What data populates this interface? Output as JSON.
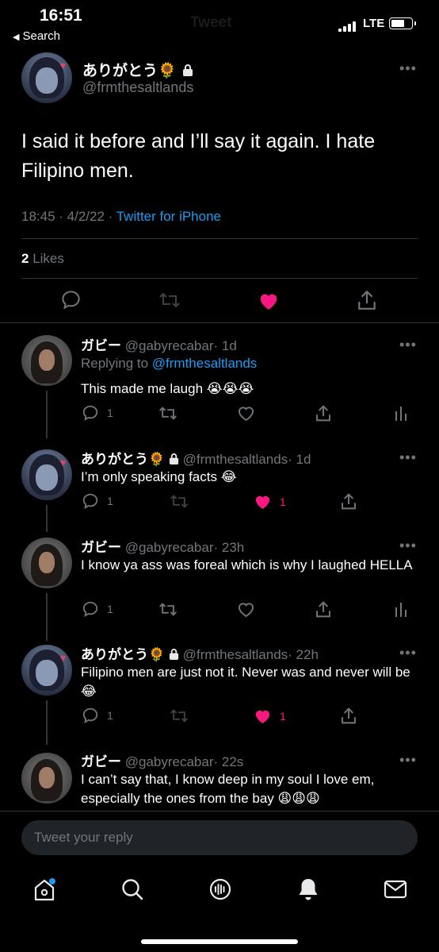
{
  "status_bar": {
    "time": "16:51",
    "back_label": "Search",
    "carrier_title": "Tweet",
    "network": "LTE"
  },
  "main_tweet": {
    "display_name": "ありがとう🌻",
    "handle": "@frmthesaltlands",
    "text": "I said it before and I’ll say it again. I hate Filipino men.",
    "timestamp": "18:45 · 4/2/22 · ",
    "source": "Twitter for iPhone",
    "likes_count": "2",
    "likes_label": " Likes"
  },
  "replies": [
    {
      "display_name": "ガビー",
      "handle": "@gabyrecabar",
      "time": "· 1d",
      "replying_to_label": "Replying to ",
      "replying_to_handle": "@frmthesaltlands",
      "text": "This made me laugh 😭😭😭",
      "reply_count": "1",
      "like_count": ""
    },
    {
      "display_name": "ありがとう🌻",
      "handle": "@frmthesaltlands",
      "time": "· 1d",
      "text": "I’m only speaking facts 😂",
      "reply_count": "1",
      "like_count": "1"
    },
    {
      "display_name": "ガビー",
      "handle": "@gabyrecabar",
      "time": "· 23h",
      "text": "I know ya ass was foreal which is why I laughed HELLA",
      "reply_count": "1",
      "like_count": ""
    },
    {
      "display_name": "ありがとう🌻",
      "handle": "@frmthesaltlands",
      "time": "· 22h",
      "text": "Filipino men are just not it. Never was and never will be 😂",
      "reply_count": "1",
      "like_count": "1"
    },
    {
      "display_name": "ガビー",
      "handle": "@gabyrecabar",
      "time": "· 22s",
      "text": "I can’t say that, I know deep in my soul I love em, especially the ones from the bay 😩😩😩"
    }
  ],
  "composer": {
    "placeholder": "Tweet your reply"
  },
  "colors": {
    "accent": "#1d9bf0",
    "like": "#f91880",
    "muted": "#71767b",
    "background": "#000000"
  },
  "icons": [
    "lock-icon",
    "more-icon",
    "reply-icon",
    "retweet-icon",
    "like-icon",
    "share-icon",
    "analytics-icon",
    "home-icon",
    "search-icon",
    "spaces-icon",
    "notifications-icon",
    "messages-icon"
  ]
}
